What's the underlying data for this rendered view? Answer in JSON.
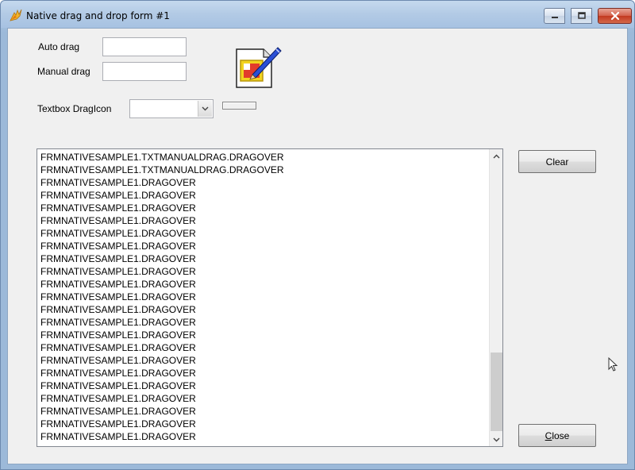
{
  "window": {
    "title": "Native drag and drop form #1",
    "icons": {
      "app": "fox-app-icon",
      "minimize": "minimize-icon",
      "maximize": "maximize-icon",
      "close": "close-icon"
    }
  },
  "form": {
    "auto_drag_label": "Auto drag",
    "auto_drag_value": "",
    "manual_drag_label": "Manual drag",
    "manual_drag_value": "",
    "drag_icon_label": "Textbox DragIcon",
    "drag_icon_value": "",
    "picture_icon": "picture-edit-icon"
  },
  "log": {
    "items": [
      "FRMNATIVESAMPLE1.TXTMANUALDRAG.DRAGOVER",
      "FRMNATIVESAMPLE1.TXTMANUALDRAG.DRAGOVER",
      "FRMNATIVESAMPLE1.DRAGOVER",
      "FRMNATIVESAMPLE1.DRAGOVER",
      "FRMNATIVESAMPLE1.DRAGOVER",
      "FRMNATIVESAMPLE1.DRAGOVER",
      "FRMNATIVESAMPLE1.DRAGOVER",
      "FRMNATIVESAMPLE1.DRAGOVER",
      "FRMNATIVESAMPLE1.DRAGOVER",
      "FRMNATIVESAMPLE1.DRAGOVER",
      "FRMNATIVESAMPLE1.DRAGOVER",
      "FRMNATIVESAMPLE1.DRAGOVER",
      "FRMNATIVESAMPLE1.DRAGOVER",
      "FRMNATIVESAMPLE1.DRAGOVER",
      "FRMNATIVESAMPLE1.DRAGOVER",
      "FRMNATIVESAMPLE1.DRAGOVER",
      "FRMNATIVESAMPLE1.DRAGOVER",
      "FRMNATIVESAMPLE1.DRAGOVER",
      "FRMNATIVESAMPLE1.DRAGOVER",
      "FRMNATIVESAMPLE1.DRAGOVER",
      "FRMNATIVESAMPLE1.DRAGOVER",
      "FRMNATIVESAMPLE1.DRAGOVER",
      "FRMNATIVESAMPLE1.DRAGOVER"
    ]
  },
  "buttons": {
    "clear": "Clear",
    "close_accel": "C",
    "close_rest": "lose"
  }
}
